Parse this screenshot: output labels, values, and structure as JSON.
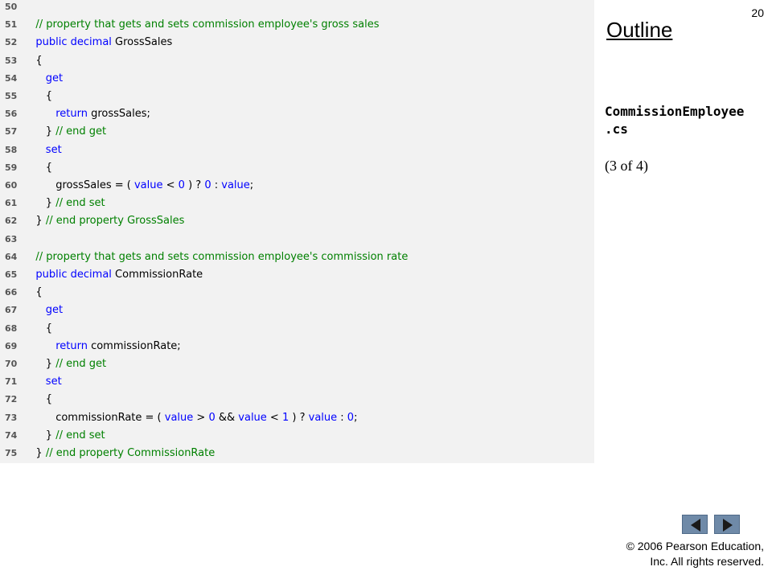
{
  "slide_number": "20",
  "outline_title": "Outline",
  "file_name_line1": "CommissionEmployee",
  "file_name_line2": ".cs",
  "page_indicator": "(3 of 4)",
  "copyright_line1": "© 2006 Pearson Education,",
  "copyright_line2": "Inc.  All rights reserved.",
  "icons": {
    "prev": "left-arrow-icon",
    "next": "right-arrow-icon"
  },
  "colors": {
    "comment": "#008000",
    "keyword": "#0000ff",
    "code_background": "#f2f2f2",
    "nav_button": "#6f8aa8"
  },
  "code_lines": [
    {
      "num": "50",
      "tokens": []
    },
    {
      "num": "51",
      "tokens": [
        {
          "t": "tx",
          "s": "   "
        },
        {
          "t": "cm",
          "s": "// property that gets and sets commission employee's gross sales"
        }
      ]
    },
    {
      "num": "52",
      "tokens": [
        {
          "t": "tx",
          "s": "   "
        },
        {
          "t": "kw",
          "s": "public decimal"
        },
        {
          "t": "tx",
          "s": " GrossSales"
        }
      ]
    },
    {
      "num": "53",
      "tokens": [
        {
          "t": "tx",
          "s": "   {"
        }
      ]
    },
    {
      "num": "54",
      "tokens": [
        {
          "t": "tx",
          "s": "      "
        },
        {
          "t": "kw",
          "s": "get"
        }
      ]
    },
    {
      "num": "55",
      "tokens": [
        {
          "t": "tx",
          "s": "      {"
        }
      ]
    },
    {
      "num": "56",
      "tokens": [
        {
          "t": "tx",
          "s": "         "
        },
        {
          "t": "kw",
          "s": "return"
        },
        {
          "t": "tx",
          "s": " grossSales;"
        }
      ]
    },
    {
      "num": "57",
      "tokens": [
        {
          "t": "tx",
          "s": "      } "
        },
        {
          "t": "cm",
          "s": "// end get"
        }
      ]
    },
    {
      "num": "58",
      "tokens": [
        {
          "t": "tx",
          "s": "      "
        },
        {
          "t": "kw",
          "s": "set"
        }
      ]
    },
    {
      "num": "59",
      "tokens": [
        {
          "t": "tx",
          "s": "      {"
        }
      ]
    },
    {
      "num": "60",
      "tokens": [
        {
          "t": "tx",
          "s": "         grossSales = ( "
        },
        {
          "t": "kw",
          "s": "value"
        },
        {
          "t": "tx",
          "s": " < "
        },
        {
          "t": "kw",
          "s": "0"
        },
        {
          "t": "tx",
          "s": " ) ? "
        },
        {
          "t": "kw",
          "s": "0"
        },
        {
          "t": "tx",
          "s": " : "
        },
        {
          "t": "kw",
          "s": "value"
        },
        {
          "t": "tx",
          "s": ";"
        }
      ]
    },
    {
      "num": "61",
      "tokens": [
        {
          "t": "tx",
          "s": "      } "
        },
        {
          "t": "cm",
          "s": "// end set"
        }
      ]
    },
    {
      "num": "62",
      "tokens": [
        {
          "t": "tx",
          "s": "   } "
        },
        {
          "t": "cm",
          "s": "// end property GrossSales"
        }
      ]
    },
    {
      "num": "63",
      "tokens": []
    },
    {
      "num": "64",
      "tokens": [
        {
          "t": "tx",
          "s": "   "
        },
        {
          "t": "cm",
          "s": "// property that gets and sets commission employee's commission rate"
        }
      ]
    },
    {
      "num": "65",
      "tokens": [
        {
          "t": "tx",
          "s": "   "
        },
        {
          "t": "kw",
          "s": "public decimal"
        },
        {
          "t": "tx",
          "s": " CommissionRate"
        }
      ]
    },
    {
      "num": "66",
      "tokens": [
        {
          "t": "tx",
          "s": "   {"
        }
      ]
    },
    {
      "num": "67",
      "tokens": [
        {
          "t": "tx",
          "s": "      "
        },
        {
          "t": "kw",
          "s": "get"
        }
      ]
    },
    {
      "num": "68",
      "tokens": [
        {
          "t": "tx",
          "s": "      {"
        }
      ]
    },
    {
      "num": "69",
      "tokens": [
        {
          "t": "tx",
          "s": "         "
        },
        {
          "t": "kw",
          "s": "return"
        },
        {
          "t": "tx",
          "s": " commissionRate;"
        }
      ]
    },
    {
      "num": "70",
      "tokens": [
        {
          "t": "tx",
          "s": "      } "
        },
        {
          "t": "cm",
          "s": "// end get"
        }
      ]
    },
    {
      "num": "71",
      "tokens": [
        {
          "t": "tx",
          "s": "      "
        },
        {
          "t": "kw",
          "s": "set"
        }
      ]
    },
    {
      "num": "72",
      "tokens": [
        {
          "t": "tx",
          "s": "      {"
        }
      ]
    },
    {
      "num": "73",
      "tokens": [
        {
          "t": "tx",
          "s": "         commissionRate = ( "
        },
        {
          "t": "kw",
          "s": "value"
        },
        {
          "t": "tx",
          "s": " > "
        },
        {
          "t": "kw",
          "s": "0"
        },
        {
          "t": "tx",
          "s": " && "
        },
        {
          "t": "kw",
          "s": "value"
        },
        {
          "t": "tx",
          "s": " < "
        },
        {
          "t": "kw",
          "s": "1"
        },
        {
          "t": "tx",
          "s": " ) ? "
        },
        {
          "t": "kw",
          "s": "value"
        },
        {
          "t": "tx",
          "s": " : "
        },
        {
          "t": "kw",
          "s": "0"
        },
        {
          "t": "tx",
          "s": ";"
        }
      ]
    },
    {
      "num": "74",
      "tokens": [
        {
          "t": "tx",
          "s": "      } "
        },
        {
          "t": "cm",
          "s": "// end set"
        }
      ]
    },
    {
      "num": "75",
      "tokens": [
        {
          "t": "tx",
          "s": "   } "
        },
        {
          "t": "cm",
          "s": "// end property CommissionRate"
        }
      ]
    }
  ]
}
